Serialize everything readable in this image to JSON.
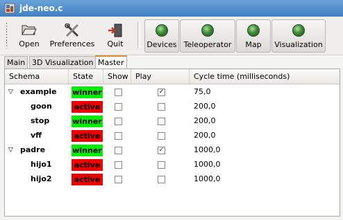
{
  "window": {
    "title": "jde-neo.c"
  },
  "toolbar": {
    "open_label": "Open",
    "preferences_label": "Preferences",
    "quit_label": "Quit",
    "devices_label": "Devices",
    "teleoperator_label": "Teleoperator",
    "map_label": "Map",
    "visualization_label": "Visualization"
  },
  "tabs": [
    {
      "label": "Main"
    },
    {
      "label": "3D Visualization"
    },
    {
      "label": "Master",
      "active": true
    }
  ],
  "columns": {
    "schema": "Schema",
    "state": "State",
    "show": "Show",
    "play": "Play",
    "cycle": "Cycle time (milliseconds)"
  },
  "rows": [
    {
      "name": "example",
      "state": "winner",
      "show": false,
      "play": true,
      "cycle": "75,0",
      "expander": true
    },
    {
      "name": "goon",
      "state": "active",
      "show": false,
      "play": false,
      "cycle": "200,0"
    },
    {
      "name": "stop",
      "state": "winner",
      "show": false,
      "play": false,
      "cycle": "200,0"
    },
    {
      "name": "vff",
      "state": "active",
      "show": false,
      "play": false,
      "cycle": "200,0"
    },
    {
      "name": "padre",
      "state": "winner",
      "show": false,
      "play": true,
      "cycle": "1000,0",
      "expander": true
    },
    {
      "name": "hijo1",
      "state": "active",
      "show": false,
      "play": false,
      "cycle": "1000,0"
    },
    {
      "name": "hijo2",
      "state": "active",
      "show": false,
      "play": false,
      "cycle": "1000,0"
    }
  ],
  "colors": {
    "winner": "#00ee00",
    "active": "#ee0000",
    "tab_accent": "#e08a2e"
  },
  "icons": {
    "app": "app-icon",
    "open": "folder-open-icon",
    "preferences": "tools-icon",
    "quit": "exit-icon",
    "status": "green-led-icon",
    "expander": "triangle-down-icon",
    "checked": "checkmark-icon"
  }
}
